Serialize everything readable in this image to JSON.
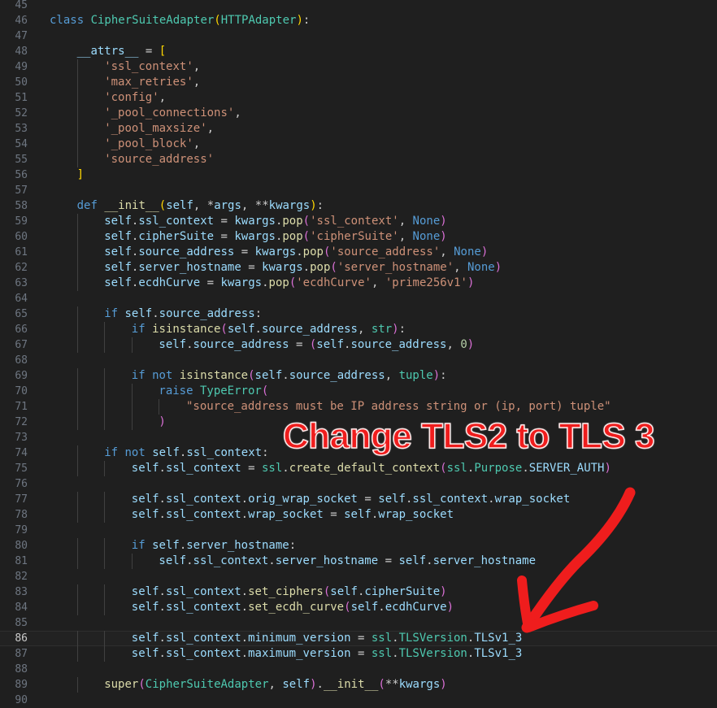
{
  "editor": {
    "lines": [
      {
        "n": "45",
        "indent": 0,
        "tokens": []
      },
      {
        "n": "46",
        "indent": 0,
        "tokens": [
          [
            "kw",
            "class "
          ],
          [
            "cls",
            "CipherSuiteAdapter"
          ],
          [
            "br",
            "("
          ],
          [
            "cls",
            "HTTPAdapter"
          ],
          [
            "br",
            ")"
          ],
          [
            "txt",
            ":"
          ]
        ]
      },
      {
        "n": "47",
        "indent": 0,
        "tokens": []
      },
      {
        "n": "48",
        "indent": 1,
        "tokens": [
          [
            "var",
            "__attrs__"
          ],
          [
            "txt",
            " = "
          ],
          [
            "br",
            "["
          ]
        ]
      },
      {
        "n": "49",
        "indent": 2,
        "tokens": [
          [
            "str",
            "'ssl_context'"
          ],
          [
            "txt",
            ","
          ]
        ]
      },
      {
        "n": "50",
        "indent": 2,
        "tokens": [
          [
            "str",
            "'max_retries'"
          ],
          [
            "txt",
            ","
          ]
        ]
      },
      {
        "n": "51",
        "indent": 2,
        "tokens": [
          [
            "str",
            "'config'"
          ],
          [
            "txt",
            ","
          ]
        ]
      },
      {
        "n": "52",
        "indent": 2,
        "tokens": [
          [
            "str",
            "'_pool_connections'"
          ],
          [
            "txt",
            ","
          ]
        ]
      },
      {
        "n": "53",
        "indent": 2,
        "tokens": [
          [
            "str",
            "'_pool_maxsize'"
          ],
          [
            "txt",
            ","
          ]
        ]
      },
      {
        "n": "54",
        "indent": 2,
        "tokens": [
          [
            "str",
            "'_pool_block'"
          ],
          [
            "txt",
            ","
          ]
        ]
      },
      {
        "n": "55",
        "indent": 2,
        "tokens": [
          [
            "str",
            "'source_address'"
          ]
        ]
      },
      {
        "n": "56",
        "indent": 1,
        "tokens": [
          [
            "br",
            "]"
          ]
        ]
      },
      {
        "n": "57",
        "indent": 0,
        "tokens": []
      },
      {
        "n": "58",
        "indent": 1,
        "tokens": [
          [
            "kw",
            "def "
          ],
          [
            "fn",
            "__init__"
          ],
          [
            "br",
            "("
          ],
          [
            "param",
            "self"
          ],
          [
            "txt",
            ", *"
          ],
          [
            "param",
            "args"
          ],
          [
            "txt",
            ", **"
          ],
          [
            "param",
            "kwargs"
          ],
          [
            "br",
            ")"
          ],
          [
            "txt",
            ":"
          ]
        ]
      },
      {
        "n": "59",
        "indent": 2,
        "tokens": [
          [
            "var",
            "self"
          ],
          [
            "txt",
            "."
          ],
          [
            "var",
            "ssl_context"
          ],
          [
            "txt",
            " = "
          ],
          [
            "var",
            "kwargs"
          ],
          [
            "txt",
            "."
          ],
          [
            "fn",
            "pop"
          ],
          [
            "br2",
            "("
          ],
          [
            "str",
            "'ssl_context'"
          ],
          [
            "txt",
            ", "
          ],
          [
            "kw",
            "None"
          ],
          [
            "br2",
            ")"
          ]
        ]
      },
      {
        "n": "60",
        "indent": 2,
        "tokens": [
          [
            "var",
            "self"
          ],
          [
            "txt",
            "."
          ],
          [
            "var",
            "cipherSuite"
          ],
          [
            "txt",
            " = "
          ],
          [
            "var",
            "kwargs"
          ],
          [
            "txt",
            "."
          ],
          [
            "fn",
            "pop"
          ],
          [
            "br2",
            "("
          ],
          [
            "str",
            "'cipherSuite'"
          ],
          [
            "txt",
            ", "
          ],
          [
            "kw",
            "None"
          ],
          [
            "br2",
            ")"
          ]
        ]
      },
      {
        "n": "61",
        "indent": 2,
        "tokens": [
          [
            "var",
            "self"
          ],
          [
            "txt",
            "."
          ],
          [
            "var",
            "source_address"
          ],
          [
            "txt",
            " = "
          ],
          [
            "var",
            "kwargs"
          ],
          [
            "txt",
            "."
          ],
          [
            "fn",
            "pop"
          ],
          [
            "br2",
            "("
          ],
          [
            "str",
            "'source_address'"
          ],
          [
            "txt",
            ", "
          ],
          [
            "kw",
            "None"
          ],
          [
            "br2",
            ")"
          ]
        ]
      },
      {
        "n": "62",
        "indent": 2,
        "tokens": [
          [
            "var",
            "self"
          ],
          [
            "txt",
            "."
          ],
          [
            "var",
            "server_hostname"
          ],
          [
            "txt",
            " = "
          ],
          [
            "var",
            "kwargs"
          ],
          [
            "txt",
            "."
          ],
          [
            "fn",
            "pop"
          ],
          [
            "br2",
            "("
          ],
          [
            "str",
            "'server_hostname'"
          ],
          [
            "txt",
            ", "
          ],
          [
            "kw",
            "None"
          ],
          [
            "br2",
            ")"
          ]
        ]
      },
      {
        "n": "63",
        "indent": 2,
        "tokens": [
          [
            "var",
            "self"
          ],
          [
            "txt",
            "."
          ],
          [
            "var",
            "ecdhCurve"
          ],
          [
            "txt",
            " = "
          ],
          [
            "var",
            "kwargs"
          ],
          [
            "txt",
            "."
          ],
          [
            "fn",
            "pop"
          ],
          [
            "br2",
            "("
          ],
          [
            "str",
            "'ecdhCurve'"
          ],
          [
            "txt",
            ", "
          ],
          [
            "str",
            "'prime256v1'"
          ],
          [
            "br2",
            ")"
          ]
        ]
      },
      {
        "n": "64",
        "indent": 0,
        "tokens": []
      },
      {
        "n": "65",
        "indent": 2,
        "tokens": [
          [
            "ctrl",
            "if "
          ],
          [
            "var",
            "self"
          ],
          [
            "txt",
            "."
          ],
          [
            "var",
            "source_address"
          ],
          [
            "txt",
            ":"
          ]
        ]
      },
      {
        "n": "66",
        "indent": 3,
        "tokens": [
          [
            "ctrl",
            "if "
          ],
          [
            "fn",
            "isinstance"
          ],
          [
            "br2",
            "("
          ],
          [
            "var",
            "self"
          ],
          [
            "txt",
            "."
          ],
          [
            "var",
            "source_address"
          ],
          [
            "txt",
            ", "
          ],
          [
            "cls",
            "str"
          ],
          [
            "br2",
            ")"
          ],
          [
            "txt",
            ":"
          ]
        ]
      },
      {
        "n": "67",
        "indent": 4,
        "tokens": [
          [
            "var",
            "self"
          ],
          [
            "txt",
            "."
          ],
          [
            "var",
            "source_address"
          ],
          [
            "txt",
            " = "
          ],
          [
            "br2",
            "("
          ],
          [
            "var",
            "self"
          ],
          [
            "txt",
            "."
          ],
          [
            "var",
            "source_address"
          ],
          [
            "txt",
            ", "
          ],
          [
            "num",
            "0"
          ],
          [
            "br2",
            ")"
          ]
        ]
      },
      {
        "n": "68",
        "indent": 0,
        "tokens": []
      },
      {
        "n": "69",
        "indent": 3,
        "tokens": [
          [
            "ctrl",
            "if "
          ],
          [
            "kw",
            "not "
          ],
          [
            "fn",
            "isinstance"
          ],
          [
            "br2",
            "("
          ],
          [
            "var",
            "self"
          ],
          [
            "txt",
            "."
          ],
          [
            "var",
            "source_address"
          ],
          [
            "txt",
            ", "
          ],
          [
            "cls",
            "tuple"
          ],
          [
            "br2",
            ")"
          ],
          [
            "txt",
            ":"
          ]
        ]
      },
      {
        "n": "70",
        "indent": 4,
        "tokens": [
          [
            "ctrl",
            "raise "
          ],
          [
            "cls",
            "TypeError"
          ],
          [
            "br2",
            "("
          ]
        ]
      },
      {
        "n": "71",
        "indent": 5,
        "tokens": [
          [
            "str",
            "\"source_address must be IP address string or (ip, port) tuple\""
          ]
        ]
      },
      {
        "n": "72",
        "indent": 4,
        "tokens": [
          [
            "br2",
            ")"
          ]
        ]
      },
      {
        "n": "73",
        "indent": 0,
        "tokens": []
      },
      {
        "n": "74",
        "indent": 2,
        "tokens": [
          [
            "ctrl",
            "if "
          ],
          [
            "kw",
            "not "
          ],
          [
            "var",
            "self"
          ],
          [
            "txt",
            "."
          ],
          [
            "var",
            "ssl_context"
          ],
          [
            "txt",
            ":"
          ]
        ]
      },
      {
        "n": "75",
        "indent": 3,
        "tokens": [
          [
            "var",
            "self"
          ],
          [
            "txt",
            "."
          ],
          [
            "var",
            "ssl_context"
          ],
          [
            "txt",
            " = "
          ],
          [
            "cls",
            "ssl"
          ],
          [
            "txt",
            "."
          ],
          [
            "fn",
            "create_default_context"
          ],
          [
            "br2",
            "("
          ],
          [
            "cls",
            "ssl"
          ],
          [
            "txt",
            "."
          ],
          [
            "cls",
            "Purpose"
          ],
          [
            "txt",
            "."
          ],
          [
            "var",
            "SERVER_AUTH"
          ],
          [
            "br2",
            ")"
          ]
        ]
      },
      {
        "n": "76",
        "indent": 0,
        "tokens": []
      },
      {
        "n": "77",
        "indent": 3,
        "tokens": [
          [
            "var",
            "self"
          ],
          [
            "txt",
            "."
          ],
          [
            "var",
            "ssl_context"
          ],
          [
            "txt",
            "."
          ],
          [
            "var",
            "orig_wrap_socket"
          ],
          [
            "txt",
            " = "
          ],
          [
            "var",
            "self"
          ],
          [
            "txt",
            "."
          ],
          [
            "var",
            "ssl_context"
          ],
          [
            "txt",
            "."
          ],
          [
            "var",
            "wrap_socket"
          ]
        ]
      },
      {
        "n": "78",
        "indent": 3,
        "tokens": [
          [
            "var",
            "self"
          ],
          [
            "txt",
            "."
          ],
          [
            "var",
            "ssl_context"
          ],
          [
            "txt",
            "."
          ],
          [
            "var",
            "wrap_socket"
          ],
          [
            "txt",
            " = "
          ],
          [
            "var",
            "self"
          ],
          [
            "txt",
            "."
          ],
          [
            "var",
            "wrap_socket"
          ]
        ]
      },
      {
        "n": "79",
        "indent": 0,
        "tokens": []
      },
      {
        "n": "80",
        "indent": 3,
        "tokens": [
          [
            "ctrl",
            "if "
          ],
          [
            "var",
            "self"
          ],
          [
            "txt",
            "."
          ],
          [
            "var",
            "server_hostname"
          ],
          [
            "txt",
            ":"
          ]
        ]
      },
      {
        "n": "81",
        "indent": 4,
        "tokens": [
          [
            "var",
            "self"
          ],
          [
            "txt",
            "."
          ],
          [
            "var",
            "ssl_context"
          ],
          [
            "txt",
            "."
          ],
          [
            "var",
            "server_hostname"
          ],
          [
            "txt",
            " = "
          ],
          [
            "var",
            "self"
          ],
          [
            "txt",
            "."
          ],
          [
            "var",
            "server_hostname"
          ]
        ]
      },
      {
        "n": "82",
        "indent": 0,
        "tokens": []
      },
      {
        "n": "83",
        "indent": 3,
        "tokens": [
          [
            "var",
            "self"
          ],
          [
            "txt",
            "."
          ],
          [
            "var",
            "ssl_context"
          ],
          [
            "txt",
            "."
          ],
          [
            "fn",
            "set_ciphers"
          ],
          [
            "br2",
            "("
          ],
          [
            "var",
            "self"
          ],
          [
            "txt",
            "."
          ],
          [
            "var",
            "cipherSuite"
          ],
          [
            "br2",
            ")"
          ]
        ]
      },
      {
        "n": "84",
        "indent": 3,
        "tokens": [
          [
            "var",
            "self"
          ],
          [
            "txt",
            "."
          ],
          [
            "var",
            "ssl_context"
          ],
          [
            "txt",
            "."
          ],
          [
            "fn",
            "set_ecdh_curve"
          ],
          [
            "br2",
            "("
          ],
          [
            "var",
            "self"
          ],
          [
            "txt",
            "."
          ],
          [
            "var",
            "ecdhCurve"
          ],
          [
            "br2",
            ")"
          ]
        ]
      },
      {
        "n": "85",
        "indent": 0,
        "tokens": []
      },
      {
        "n": "86",
        "indent": 3,
        "current": true,
        "tokens": [
          [
            "var",
            "self"
          ],
          [
            "txt",
            "."
          ],
          [
            "var",
            "ssl_context"
          ],
          [
            "txt",
            "."
          ],
          [
            "var",
            "minimum_version"
          ],
          [
            "txt",
            " = "
          ],
          [
            "cls",
            "ssl"
          ],
          [
            "txt",
            "."
          ],
          [
            "cls",
            "TLSVersion"
          ],
          [
            "txt",
            "."
          ],
          [
            "var",
            "TLSv1_3"
          ]
        ]
      },
      {
        "n": "87",
        "indent": 3,
        "tokens": [
          [
            "var",
            "self"
          ],
          [
            "txt",
            "."
          ],
          [
            "var",
            "ssl_context"
          ],
          [
            "txt",
            "."
          ],
          [
            "var",
            "maximum_version"
          ],
          [
            "txt",
            " = "
          ],
          [
            "cls",
            "ssl"
          ],
          [
            "txt",
            "."
          ],
          [
            "cls",
            "TLSVersion"
          ],
          [
            "txt",
            "."
          ],
          [
            "var",
            "TLSv1_3"
          ]
        ]
      },
      {
        "n": "88",
        "indent": 0,
        "tokens": []
      },
      {
        "n": "89",
        "indent": 2,
        "tokens": [
          [
            "fn",
            "super"
          ],
          [
            "br2",
            "("
          ],
          [
            "cls",
            "CipherSuiteAdapter"
          ],
          [
            "txt",
            ", "
          ],
          [
            "var",
            "self"
          ],
          [
            "br2",
            ")"
          ],
          [
            "txt",
            "."
          ],
          [
            "fn",
            "__init__"
          ],
          [
            "br2",
            "("
          ],
          [
            "txt",
            "**"
          ],
          [
            "var",
            "kwargs"
          ],
          [
            "br2",
            ")"
          ]
        ]
      },
      {
        "n": "90",
        "indent": 0,
        "tokens": []
      }
    ]
  },
  "annotation": {
    "text": "Change TLS2 to TLS 3",
    "color": "#ef1d1d",
    "target_line": "86"
  }
}
